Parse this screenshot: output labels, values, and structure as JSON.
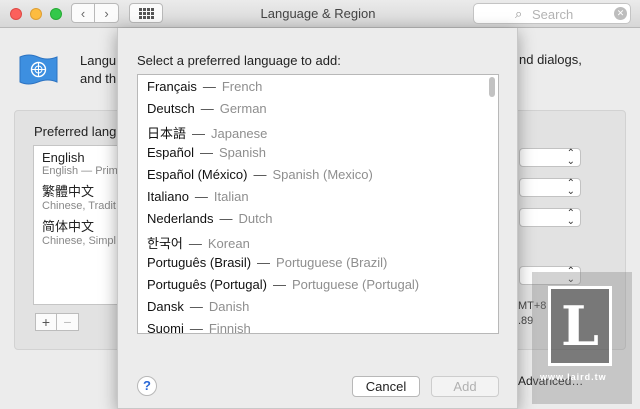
{
  "window": {
    "title": "Language & Region",
    "search_placeholder": "Search",
    "nav_back": "‹",
    "nav_forward": "›"
  },
  "background": {
    "header_left_line1": "Langu",
    "header_left_line2": "and th",
    "header_right_text": "nd dialogs,",
    "preferred_label": "Preferred lang",
    "languages": [
      {
        "name": "English",
        "sub": "English — Prim"
      },
      {
        "name": "繁體中文",
        "sub": "Chinese, Tradit"
      },
      {
        "name": "简体中文",
        "sub": "Chinese, Simpl"
      }
    ],
    "add_symbol": "+",
    "remove_symbol": "−",
    "region_text1": "MT+8",
    "region_text2": ".89",
    "advanced_label": "Advanced…",
    "watermark_letter": "L",
    "watermark_text": "www.laird.tw"
  },
  "sheet": {
    "title": "Select a preferred language to add:",
    "separator": "—",
    "languages": [
      {
        "native": "Français",
        "english": "French"
      },
      {
        "native": "Deutsch",
        "english": "German"
      },
      {
        "native": "日本語",
        "english": "Japanese"
      },
      {
        "native": "Español",
        "english": "Spanish"
      },
      {
        "native": "Español (México)",
        "english": "Spanish (Mexico)"
      },
      {
        "native": "Italiano",
        "english": "Italian"
      },
      {
        "native": "Nederlands",
        "english": "Dutch"
      },
      {
        "native": "한국어",
        "english": "Korean"
      },
      {
        "native": "Português (Brasil)",
        "english": "Portuguese (Brazil)"
      },
      {
        "native": "Português (Portugal)",
        "english": "Portuguese (Portugal)"
      },
      {
        "native": "Dansk",
        "english": "Danish"
      },
      {
        "native": "Suomi",
        "english": "Finnish"
      }
    ],
    "help_label": "?",
    "cancel_label": "Cancel",
    "add_label": "Add"
  }
}
